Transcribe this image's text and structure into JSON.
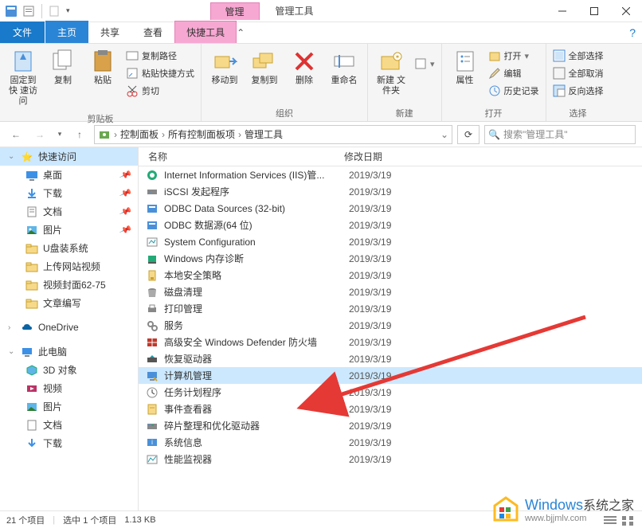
{
  "titlebar": {
    "context_tab": "管理",
    "window_title": "管理工具"
  },
  "ribbon_tabs": {
    "file": "文件",
    "home": "主页",
    "share": "共享",
    "view": "查看",
    "shortcut_tools": "快捷工具"
  },
  "ribbon": {
    "pin": "固定到快\n速访问",
    "copy": "复制",
    "paste": "粘贴",
    "copy_path": "复制路径",
    "paste_shortcut": "粘贴快捷方式",
    "cut": "剪切",
    "clipboard_group": "剪贴板",
    "move_to": "移动到",
    "copy_to": "复制到",
    "delete": "删除",
    "rename": "重命名",
    "organize_group": "组织",
    "new_folder": "新建\n文件夹",
    "new_group": "新建",
    "properties": "属性",
    "open": "打开",
    "edit": "编辑",
    "history": "历史记录",
    "open_group": "打开",
    "select_all": "全部选择",
    "select_none": "全部取消",
    "invert_selection": "反向选择",
    "select_group": "选择"
  },
  "breadcrumbs": [
    "控制面板",
    "所有控制面板项",
    "管理工具"
  ],
  "search": {
    "placeholder": "搜索\"管理工具\""
  },
  "nav": {
    "quick_access": "快速访问",
    "desktop": "桌面",
    "downloads": "下载",
    "documents": "文档",
    "pictures": "图片",
    "u_disk": "U盘装系统",
    "upload_site": "上传网站视频",
    "video_cover": "视频封面62-75",
    "article_edit": "文章编写",
    "onedrive": "OneDrive",
    "this_pc": "此电脑",
    "objects3d": "3D 对象",
    "videos": "视频",
    "pictures2": "图片",
    "documents2": "文档",
    "downloads2": "下载"
  },
  "columns": {
    "name": "名称",
    "date_modified": "修改日期"
  },
  "files": [
    {
      "name": "Internet Information Services (IIS)管...",
      "date": "2019/3/19",
      "icon": "iis"
    },
    {
      "name": "iSCSI 发起程序",
      "date": "2019/3/19",
      "icon": "iscsi"
    },
    {
      "name": "ODBC Data Sources (32-bit)",
      "date": "2019/3/19",
      "icon": "odbc"
    },
    {
      "name": "ODBC 数据源(64 位)",
      "date": "2019/3/19",
      "icon": "odbc"
    },
    {
      "name": "System Configuration",
      "date": "2019/3/19",
      "icon": "sysconfig"
    },
    {
      "name": "Windows 内存诊断",
      "date": "2019/3/19",
      "icon": "memdiag"
    },
    {
      "name": "本地安全策略",
      "date": "2019/3/19",
      "icon": "secpol"
    },
    {
      "name": "磁盘清理",
      "date": "2019/3/19",
      "icon": "cleanmgr"
    },
    {
      "name": "打印管理",
      "date": "2019/3/19",
      "icon": "printmgmt"
    },
    {
      "name": "服务",
      "date": "2019/3/19",
      "icon": "services"
    },
    {
      "name": "高级安全 Windows Defender 防火墙",
      "date": "2019/3/19",
      "icon": "firewall"
    },
    {
      "name": "恢复驱动器",
      "date": "2019/3/19",
      "icon": "recovery"
    },
    {
      "name": "计算机管理",
      "date": "2019/3/19",
      "icon": "compmgmt",
      "selected": true
    },
    {
      "name": "任务计划程序",
      "date": "2019/3/19",
      "icon": "tasksched"
    },
    {
      "name": "事件查看器",
      "date": "2019/3/19",
      "icon": "eventvwr"
    },
    {
      "name": "碎片整理和优化驱动器",
      "date": "2019/3/19",
      "icon": "defrag"
    },
    {
      "name": "系统信息",
      "date": "2019/3/19",
      "icon": "sysinfo"
    },
    {
      "name": "性能监视器",
      "date": "2019/3/19",
      "icon": "perfmon"
    }
  ],
  "status": {
    "item_count": "21 个项目",
    "selection": "选中 1 个项目",
    "size": "1.13 KB"
  },
  "watermark": {
    "brand": "Windows",
    "brand_suffix": "系统之家",
    "url": "www.bjjmlv.com"
  }
}
